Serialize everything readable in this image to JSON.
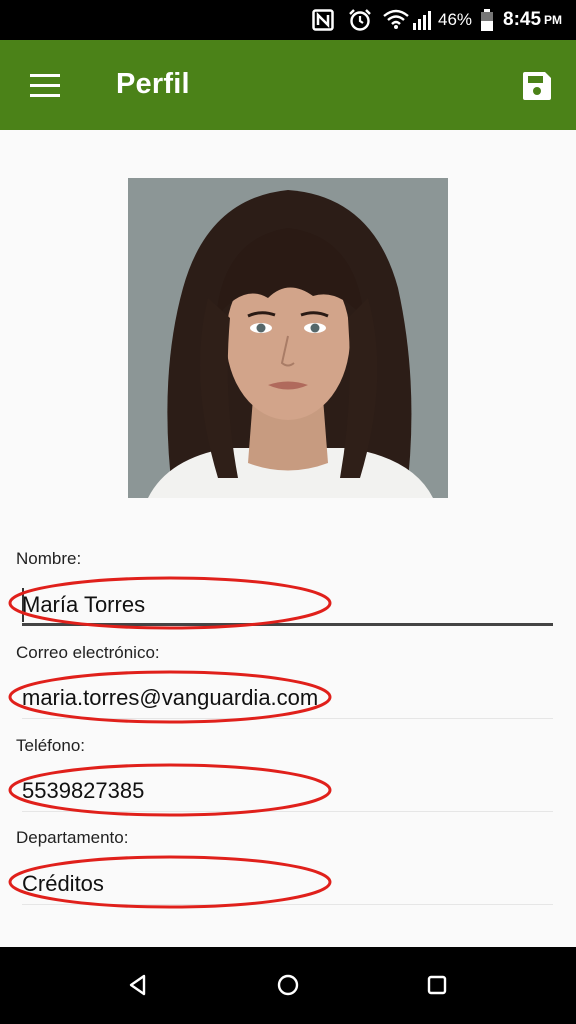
{
  "status_bar": {
    "battery_percent": "46%",
    "time": "8:45",
    "time_suffix": "PM",
    "icons": [
      "nfc-icon",
      "alarm-icon",
      "wifi-icon",
      "signal-icon",
      "battery-icon"
    ]
  },
  "app_bar": {
    "title": "Perfil",
    "menu_icon": "hamburger-menu-icon",
    "save_icon": "save-icon",
    "background": "#4b8218"
  },
  "profile": {
    "photo_description": "profile-photo"
  },
  "fields": {
    "nombre": {
      "label": "Nombre:",
      "value": "María Torres"
    },
    "correo": {
      "label": "Correo electrónico:",
      "value": "maria.torres@vanguardia.com"
    },
    "telefono": {
      "label": "Teléfono:",
      "value": "5539827385"
    },
    "departamento": {
      "label": "Departamento:",
      "value": "Créditos"
    }
  },
  "annotation": {
    "color": "#e0201b"
  },
  "nav_bar": {
    "icons": [
      "back-icon",
      "home-icon",
      "recents-icon"
    ]
  }
}
